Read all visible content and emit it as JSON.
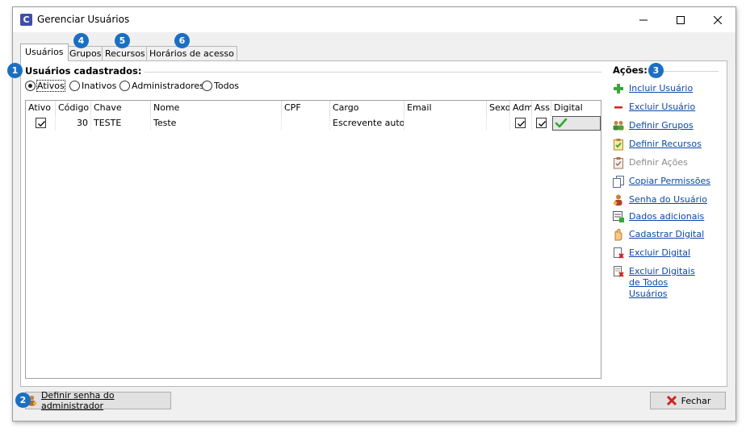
{
  "window": {
    "title": "Gerenciar Usuários",
    "icon_letter": "C"
  },
  "tabs": [
    {
      "label": "Usuários",
      "active": true
    },
    {
      "label": "Grupos",
      "active": false
    },
    {
      "label": "Recursos",
      "active": false
    },
    {
      "label": "Horários de acesso",
      "active": false
    }
  ],
  "badges": [
    "1",
    "2",
    "3",
    "4",
    "5",
    "6"
  ],
  "users_section": {
    "title": "Usuários cadastrados:"
  },
  "filters": [
    {
      "label": "Ativos",
      "selected": true
    },
    {
      "label": "Inativos",
      "selected": false
    },
    {
      "label": "Administradores",
      "selected": false
    },
    {
      "label": "Todos",
      "selected": false
    }
  ],
  "grid": {
    "columns": [
      "Ativo",
      "Código",
      "Chave",
      "Nome",
      "CPF",
      "Cargo",
      "Email",
      "Sexo",
      "Adm",
      "Ass.",
      "Digital"
    ],
    "rows": [
      {
        "ativo": true,
        "codigo": "30",
        "chave": "TESTE",
        "nome": "Teste",
        "cpf": "",
        "cargo": "Escrevente autoriz",
        "email": "",
        "sexo": "",
        "adm": true,
        "ass": true,
        "digital": true
      }
    ]
  },
  "actions_section": {
    "title": "Ações:",
    "items": [
      {
        "label": "Incluir Usuário",
        "icon": "plus-icon",
        "enabled": true
      },
      {
        "label": "Excluir Usuário",
        "icon": "minus-icon",
        "enabled": true
      },
      {
        "label": "Definir Grupos",
        "icon": "group-icon",
        "enabled": true
      },
      {
        "label": "Definir Recursos",
        "icon": "clipboard-check-icon",
        "enabled": true
      },
      {
        "label": "Definir Ações",
        "icon": "clipboard-icon",
        "enabled": false
      },
      {
        "label": "Copiar Permissões",
        "icon": "copy-icon",
        "enabled": true
      },
      {
        "label": "Senha do Usuário",
        "icon": "user-key-icon",
        "enabled": true
      },
      {
        "label": "Dados adicionais",
        "icon": "data-add-icon",
        "enabled": true
      },
      {
        "label": "Cadastrar Digital",
        "icon": "fingerprint-hand-icon",
        "enabled": true
      },
      {
        "label": "Excluir Digital",
        "icon": "delete-document-icon",
        "enabled": true
      },
      {
        "label": "Excluir Digitais de Todos Usuários",
        "icon": "delete-all-icon",
        "enabled": true
      }
    ]
  },
  "footer": {
    "admin_button": "Definir senha do administrador",
    "close_button": "Fechar"
  },
  "colors": {
    "accent": "#1a6fc2",
    "link": "#0b47a8",
    "app_icon": "#3f4ea7"
  }
}
